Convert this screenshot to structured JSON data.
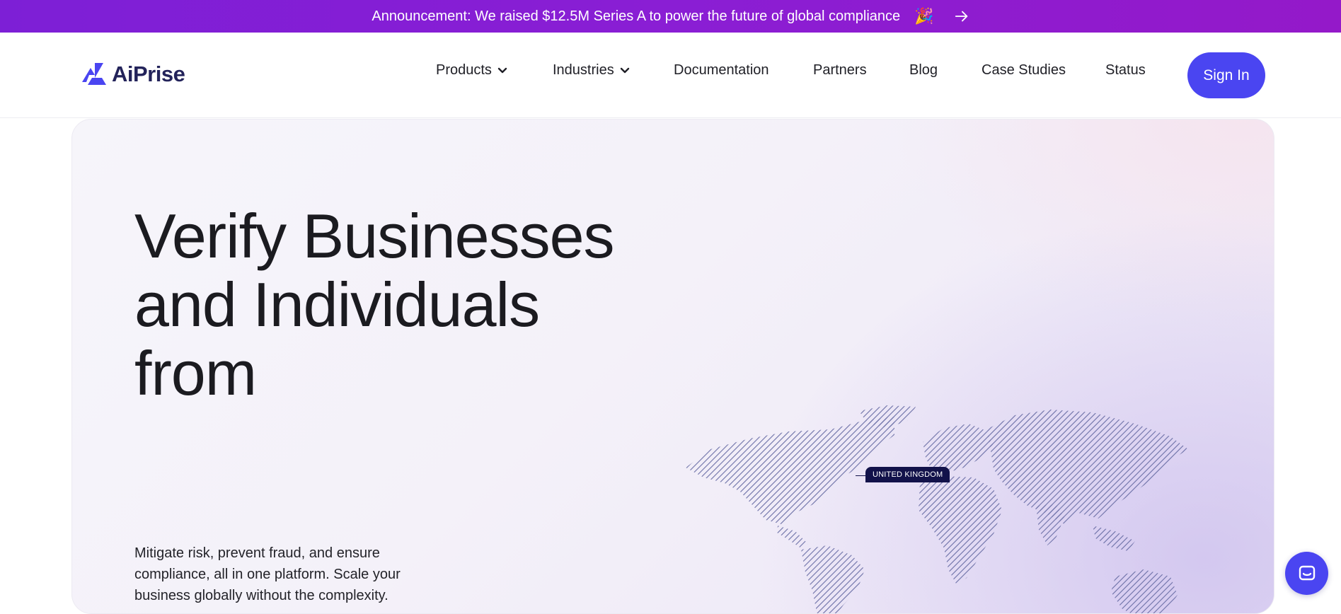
{
  "announcement": {
    "text": "Announcement: We raised $12.5M Series A to power the future of global compliance",
    "emoji": "🎉",
    "arrow_icon": "arrow-right-icon"
  },
  "nav": {
    "logo_text": "AiPrise",
    "items": [
      {
        "label": "Products",
        "has_dropdown": true
      },
      {
        "label": "Industries",
        "has_dropdown": true
      },
      {
        "label": "Documentation",
        "has_dropdown": false
      },
      {
        "label": "Partners",
        "has_dropdown": false
      },
      {
        "label": "Blog",
        "has_dropdown": false
      },
      {
        "label": "Case Studies",
        "has_dropdown": false
      },
      {
        "label": "Status",
        "has_dropdown": false
      }
    ],
    "signin_label": "Sign In"
  },
  "hero": {
    "headline_line1": "Verify Businesses",
    "headline_line2": "and Individuals",
    "headline_line3": "from",
    "rotating_word": "United Kingdom",
    "subtext": "Mitigate risk, prevent fraud, and ensure compliance, all in one platform. Scale your business globally without the complexity.",
    "map_badge": "UNITED KINGDOM"
  },
  "colors": {
    "brand": "#4a45f1",
    "announcement_start": "#7d1fd6",
    "announcement_end": "#9419c9",
    "logo_text": "#23235a",
    "badge": "#12124a"
  },
  "icons": {
    "chat": "chat-bubble-icon",
    "dropdown": "chevron-down-icon"
  }
}
